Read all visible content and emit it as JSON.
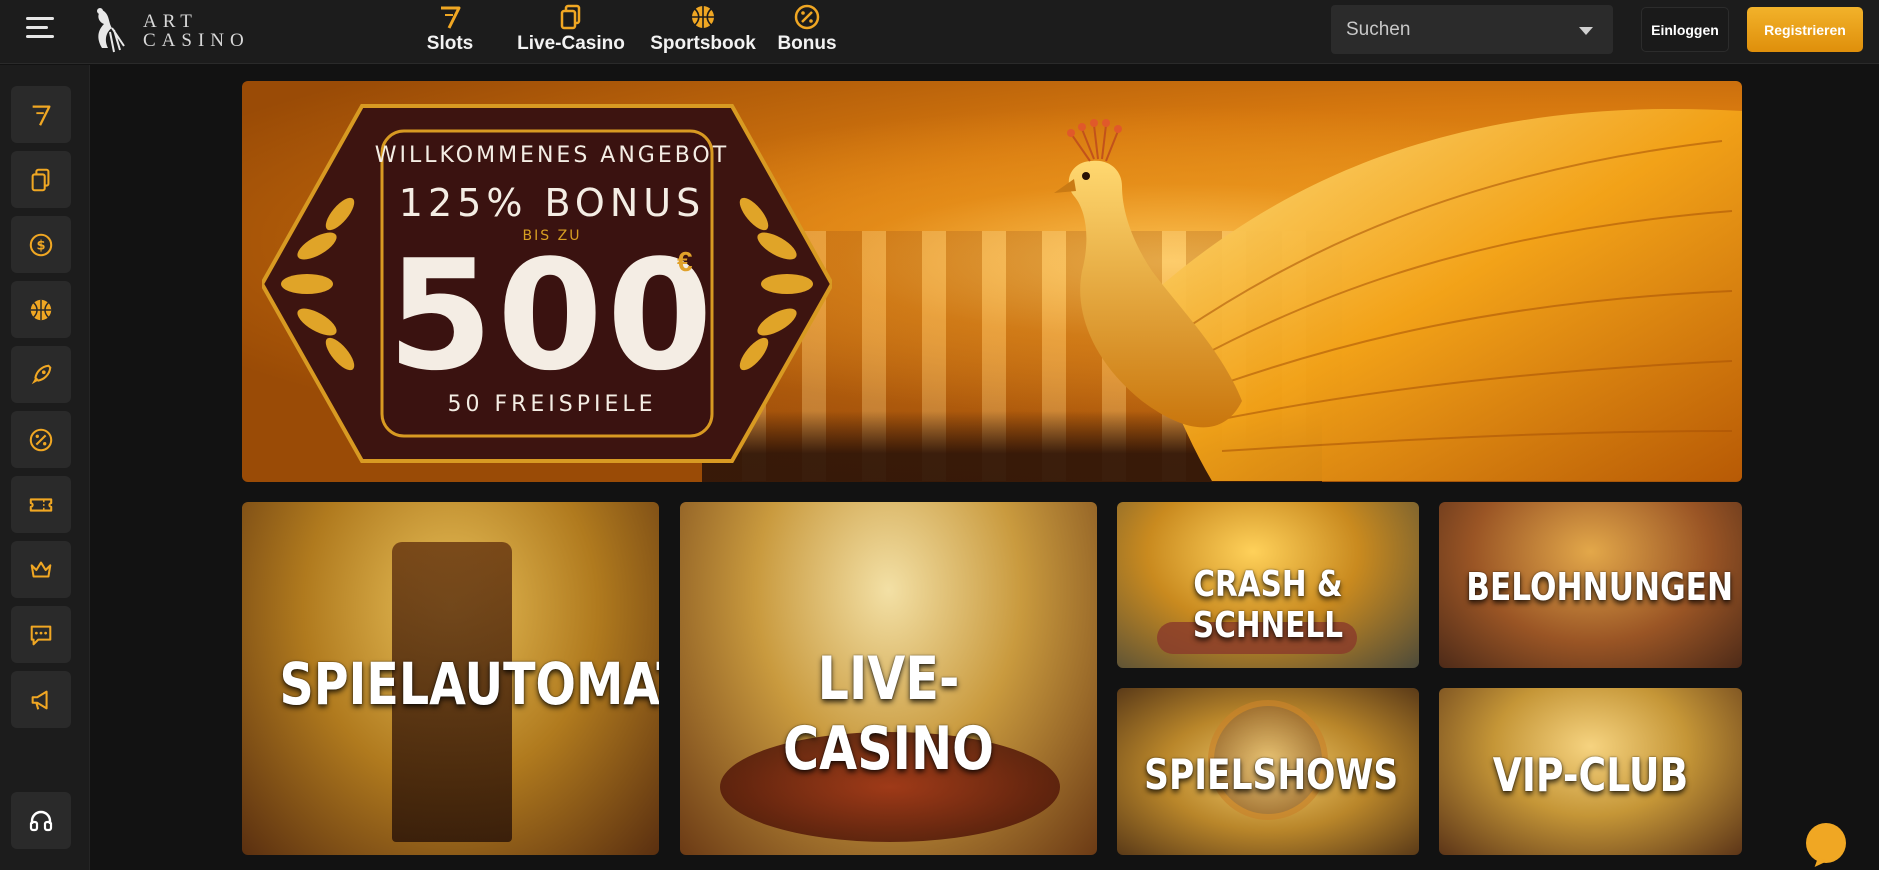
{
  "header": {
    "logo_line1": "ART",
    "logo_line2": "CASINO",
    "nav": [
      {
        "label": "Slots",
        "icon": "slot-seven-icon"
      },
      {
        "label": "Live-Casino",
        "icon": "cards-icon"
      },
      {
        "label": "Sportsbook",
        "icon": "basketball-icon"
      },
      {
        "label": "Bonus",
        "icon": "percent-badge-icon"
      }
    ],
    "search_placeholder": "Suchen",
    "login_label": "Einloggen",
    "register_label": "Registrieren"
  },
  "sidebar": {
    "items": [
      {
        "icon": "slot-seven-icon"
      },
      {
        "icon": "cards-icon"
      },
      {
        "icon": "dollar-coin-icon"
      },
      {
        "icon": "basketball-icon"
      },
      {
        "icon": "rocket-icon"
      },
      {
        "icon": "percent-badge-icon"
      },
      {
        "icon": "ticket-icon"
      },
      {
        "icon": "crown-icon"
      },
      {
        "icon": "chat-icon"
      },
      {
        "icon": "megaphone-icon"
      }
    ],
    "support_icon": "headset-icon"
  },
  "banner": {
    "offer": "WILLKOMMENES ANGEBOT",
    "bonus": "125% BONUS",
    "upto": "BIS ZU",
    "amount": "500",
    "currency": "€",
    "spins": "50 FREISPIELE"
  },
  "tiles": {
    "slots": "SPIELAUTOMATEN",
    "live": "LIVE-CASINO",
    "crash": "CRASH & SCHNELL",
    "rewards": "BELOHNUNGEN",
    "shows": "SPIELSHOWS",
    "vip": "VIP-CLUB"
  },
  "colors": {
    "accent": "#f0a723",
    "background": "#121212",
    "panel": "#1c1c1c"
  }
}
